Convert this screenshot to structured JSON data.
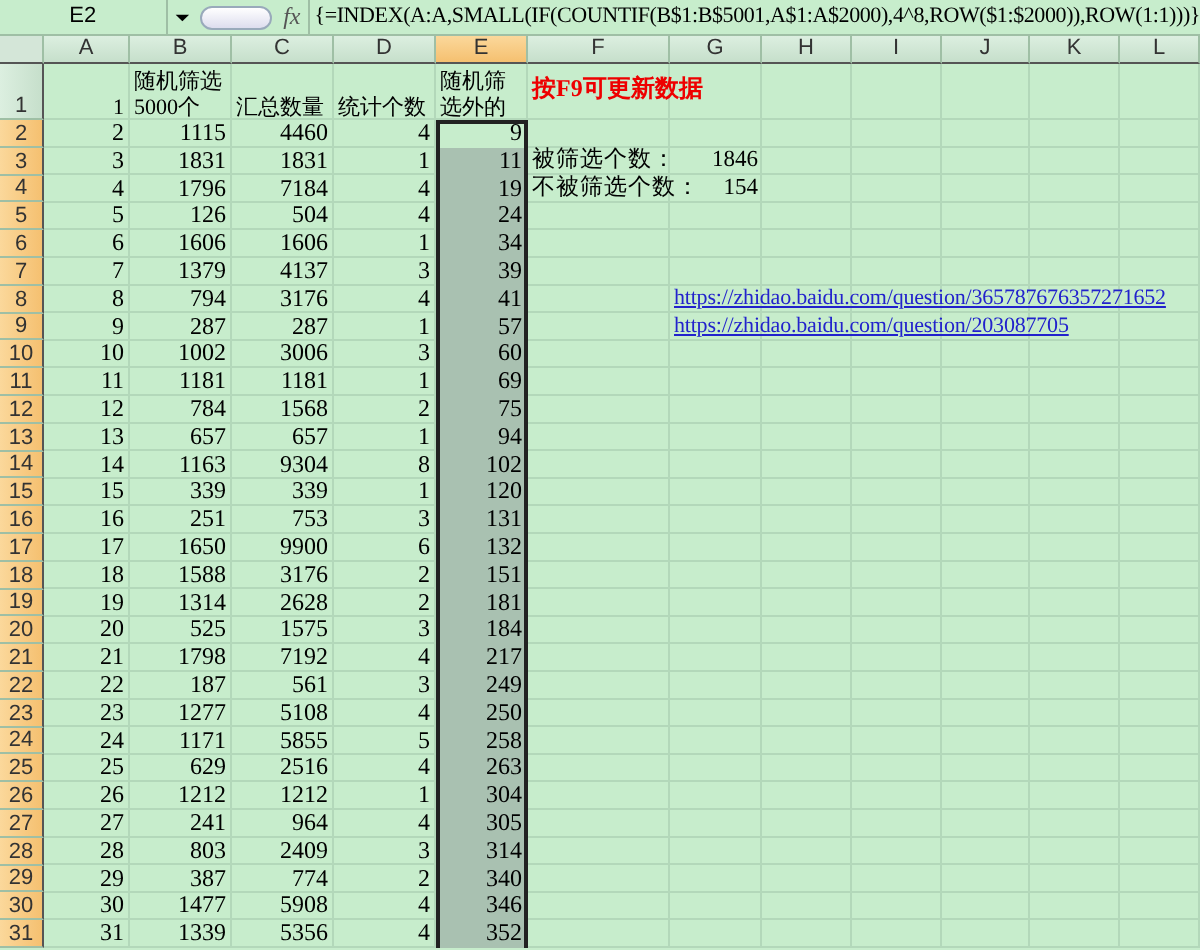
{
  "formula_bar": {
    "name_box": "E2",
    "fx": "fx",
    "formula": "{=INDEX(A:A,SMALL(IF(COUNTIF(B$1:B$5001,A$1:A$2000),4^8,ROW($1:$2000)),ROW(1:1)))}"
  },
  "columns": [
    {
      "label": "A",
      "selected": false
    },
    {
      "label": "B",
      "selected": false
    },
    {
      "label": "C",
      "selected": false
    },
    {
      "label": "D",
      "selected": false
    },
    {
      "label": "E",
      "selected": true
    },
    {
      "label": "F",
      "selected": false
    },
    {
      "label": "G",
      "selected": false
    },
    {
      "label": "H",
      "selected": false
    },
    {
      "label": "I",
      "selected": false
    },
    {
      "label": "J",
      "selected": false
    },
    {
      "label": "K",
      "selected": false
    },
    {
      "label": "L",
      "selected": false
    }
  ],
  "rows": [
    {
      "number": "1",
      "kind": "header",
      "selected": false,
      "cells": [
        "1",
        "随机筛选5000个",
        "汇总数量",
        "统计个数",
        "随机筛选外的"
      ],
      "col_f": {
        "kind": "note",
        "text": "按F9可更新数据"
      }
    },
    {
      "number": "2",
      "kind": "data",
      "selected": true,
      "cells": [
        "2",
        "1115",
        "4460",
        "4",
        "9"
      ]
    },
    {
      "number": "3",
      "kind": "data",
      "selected": true,
      "cells": [
        "3",
        "1831",
        "1831",
        "1",
        "11"
      ],
      "col_f": {
        "kind": "text",
        "text": "被筛选个数："
      },
      "col_g": {
        "kind": "number",
        "text": "1846"
      }
    },
    {
      "number": "4",
      "kind": "data",
      "selected": true,
      "cells": [
        "4",
        "1796",
        "7184",
        "4",
        "19"
      ],
      "col_f": {
        "kind": "text",
        "text": "不被筛选个数："
      },
      "col_g": {
        "kind": "number",
        "text": "154"
      }
    },
    {
      "number": "5",
      "kind": "data",
      "selected": true,
      "cells": [
        "5",
        "126",
        "504",
        "4",
        "24"
      ]
    },
    {
      "number": "6",
      "kind": "data",
      "selected": true,
      "cells": [
        "6",
        "1606",
        "1606",
        "1",
        "34"
      ]
    },
    {
      "number": "7",
      "kind": "data",
      "selected": true,
      "cells": [
        "7",
        "1379",
        "4137",
        "3",
        "39"
      ]
    },
    {
      "number": "8",
      "kind": "data",
      "selected": true,
      "cells": [
        "8",
        "794",
        "3176",
        "4",
        "41"
      ],
      "col_g": {
        "kind": "link",
        "text": "https://zhidao.baidu.com/question/365787676357271652"
      }
    },
    {
      "number": "9",
      "kind": "data",
      "selected": true,
      "cells": [
        "9",
        "287",
        "287",
        "1",
        "57"
      ],
      "col_g": {
        "kind": "link",
        "text": "https://zhidao.baidu.com/question/203087705"
      }
    },
    {
      "number": "10",
      "kind": "data",
      "selected": true,
      "cells": [
        "10",
        "1002",
        "3006",
        "3",
        "60"
      ]
    },
    {
      "number": "11",
      "kind": "data",
      "selected": true,
      "cells": [
        "11",
        "1181",
        "1181",
        "1",
        "69"
      ]
    },
    {
      "number": "12",
      "kind": "data",
      "selected": true,
      "cells": [
        "12",
        "784",
        "1568",
        "2",
        "75"
      ]
    },
    {
      "number": "13",
      "kind": "data",
      "selected": true,
      "cells": [
        "13",
        "657",
        "657",
        "1",
        "94"
      ]
    },
    {
      "number": "14",
      "kind": "data",
      "selected": true,
      "cells": [
        "14",
        "1163",
        "9304",
        "8",
        "102"
      ]
    },
    {
      "number": "15",
      "kind": "data",
      "selected": true,
      "cells": [
        "15",
        "339",
        "339",
        "1",
        "120"
      ]
    },
    {
      "number": "16",
      "kind": "data",
      "selected": true,
      "cells": [
        "16",
        "251",
        "753",
        "3",
        "131"
      ]
    },
    {
      "number": "17",
      "kind": "data",
      "selected": true,
      "cells": [
        "17",
        "1650",
        "9900",
        "6",
        "132"
      ]
    },
    {
      "number": "18",
      "kind": "data",
      "selected": true,
      "cells": [
        "18",
        "1588",
        "3176",
        "2",
        "151"
      ]
    },
    {
      "number": "19",
      "kind": "data",
      "selected": true,
      "cells": [
        "19",
        "1314",
        "2628",
        "2",
        "181"
      ]
    },
    {
      "number": "20",
      "kind": "data",
      "selected": true,
      "cells": [
        "20",
        "525",
        "1575",
        "3",
        "184"
      ]
    },
    {
      "number": "21",
      "kind": "data",
      "selected": true,
      "cells": [
        "21",
        "1798",
        "7192",
        "4",
        "217"
      ]
    },
    {
      "number": "22",
      "kind": "data",
      "selected": true,
      "cells": [
        "22",
        "187",
        "561",
        "3",
        "249"
      ]
    },
    {
      "number": "23",
      "kind": "data",
      "selected": true,
      "cells": [
        "23",
        "1277",
        "5108",
        "4",
        "250"
      ]
    },
    {
      "number": "24",
      "kind": "data",
      "selected": true,
      "cells": [
        "24",
        "1171",
        "5855",
        "5",
        "258"
      ]
    },
    {
      "number": "25",
      "kind": "data",
      "selected": true,
      "cells": [
        "25",
        "629",
        "2516",
        "4",
        "263"
      ]
    },
    {
      "number": "26",
      "kind": "data",
      "selected": true,
      "cells": [
        "26",
        "1212",
        "1212",
        "1",
        "304"
      ]
    },
    {
      "number": "27",
      "kind": "data",
      "selected": true,
      "cells": [
        "27",
        "241",
        "964",
        "4",
        "305"
      ]
    },
    {
      "number": "28",
      "kind": "data",
      "selected": true,
      "cells": [
        "28",
        "803",
        "2409",
        "3",
        "314"
      ]
    },
    {
      "number": "29",
      "kind": "data",
      "selected": true,
      "cells": [
        "29",
        "387",
        "774",
        "2",
        "340"
      ]
    },
    {
      "number": "30",
      "kind": "data",
      "selected": true,
      "cells": [
        "30",
        "1477",
        "5908",
        "4",
        "346"
      ]
    },
    {
      "number": "31",
      "kind": "data",
      "selected": true,
      "cells": [
        "31",
        "1339",
        "5356",
        "4",
        "352"
      ]
    }
  ]
}
